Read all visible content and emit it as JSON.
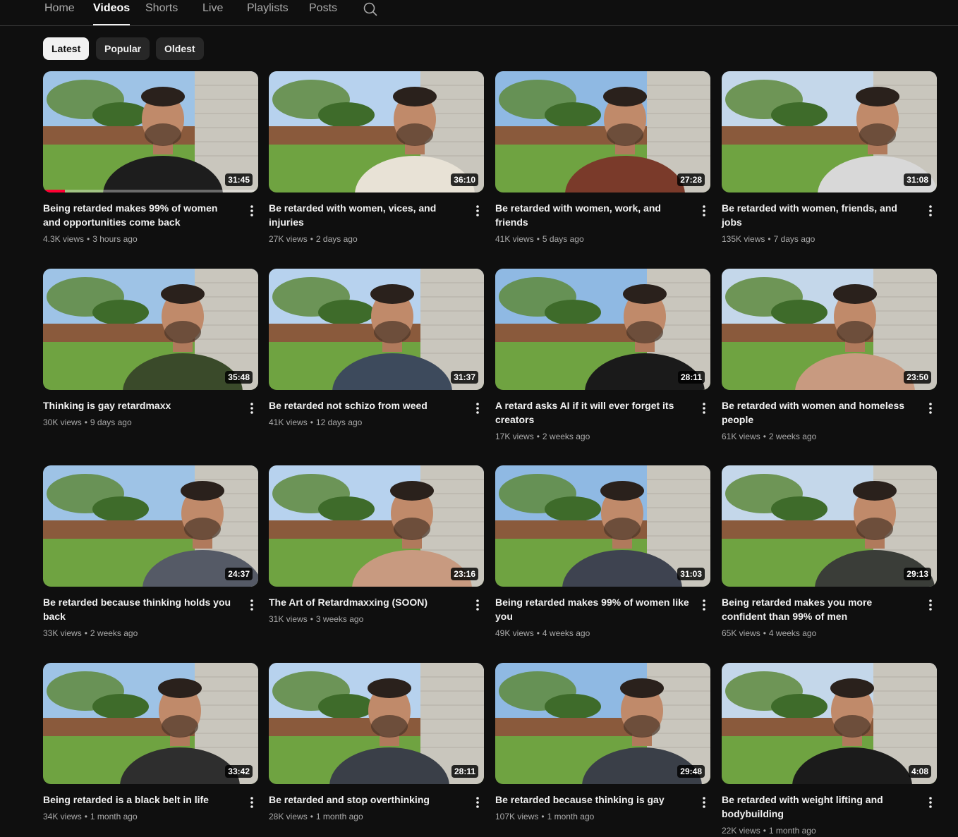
{
  "tabs": [
    {
      "label": "Home"
    },
    {
      "label": "Videos",
      "active": true
    },
    {
      "label": "Shorts"
    },
    {
      "label": "Live"
    },
    {
      "label": "Playlists"
    },
    {
      "label": "Posts"
    }
  ],
  "chips": [
    {
      "label": "Latest",
      "active": true
    },
    {
      "label": "Popular"
    },
    {
      "label": "Oldest"
    }
  ],
  "colors": {
    "background": "#0f0f0f",
    "chip": "#272727",
    "progress": "#ff0033",
    "meta_text": "#aaaaaa"
  },
  "videos": [
    {
      "title": "Being retarded makes 99% of women and opportunities come back",
      "views": "4.3K views",
      "age": "3 hours ago",
      "duration": "31:45",
      "watch_progress": 0.1
    },
    {
      "title": "Be retarded with women, vices, and injuries",
      "views": "27K views",
      "age": "2 days ago",
      "duration": "36:10"
    },
    {
      "title": "Be retarded with women, work, and friends",
      "views": "41K views",
      "age": "5 days ago",
      "duration": "27:28"
    },
    {
      "title": "Be retarded with women, friends, and jobs",
      "views": "135K views",
      "age": "7 days ago",
      "duration": "31:08"
    },
    {
      "title": "Thinking is gay retardmaxx",
      "views": "30K views",
      "age": "9 days ago",
      "duration": "35:48"
    },
    {
      "title": "Be retarded not schizo from weed",
      "views": "41K views",
      "age": "12 days ago",
      "duration": "31:37"
    },
    {
      "title": "A retard asks AI if it will ever forget its creators",
      "views": "17K views",
      "age": "2 weeks ago",
      "duration": "28:11"
    },
    {
      "title": "Be retarded with women and homeless people",
      "views": "61K views",
      "age": "2 weeks ago",
      "duration": "23:50"
    },
    {
      "title": "Be retarded because thinking holds you back",
      "views": "33K views",
      "age": "2 weeks ago",
      "duration": "24:37"
    },
    {
      "title": "The Art of Retardmaxxing (SOON)",
      "views": "31K views",
      "age": "3 weeks ago",
      "duration": "23:16"
    },
    {
      "title": "Being retarded makes 99% of women like you",
      "views": "49K views",
      "age": "4 weeks ago",
      "duration": "31:03"
    },
    {
      "title": "Being retarded makes you more confident than 99% of men",
      "views": "65K views",
      "age": "4 weeks ago",
      "duration": "29:13"
    },
    {
      "title": "Being retarded is a black belt in life",
      "views": "34K views",
      "age": "1 month ago",
      "duration": "33:42"
    },
    {
      "title": "Be retarded and stop overthinking",
      "views": "28K views",
      "age": "1 month ago",
      "duration": "28:11"
    },
    {
      "title": "Be retarded because thinking is gay",
      "views": "107K views",
      "age": "1 month ago",
      "duration": "29:48"
    },
    {
      "title": "Be retarded with weight lifting and bodybuilding",
      "views": "22K views",
      "age": "1 month ago",
      "duration": "4:08"
    }
  ]
}
